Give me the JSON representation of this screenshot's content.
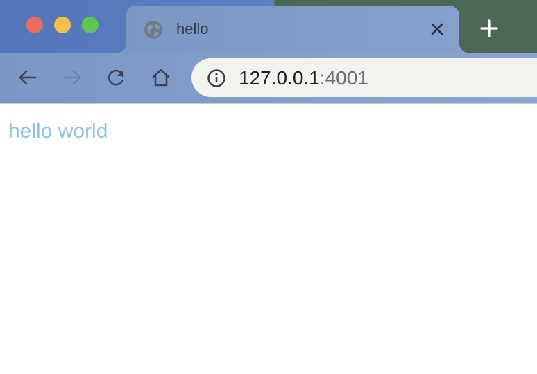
{
  "tab": {
    "title": "hello",
    "favicon_icon": "globe-icon",
    "close_icon": "close-icon"
  },
  "new_tab_icon": "plus-icon",
  "toolbar": {
    "back_icon": "arrow-left-icon",
    "forward_icon": "arrow-right-icon",
    "reload_icon": "reload-icon",
    "home_icon": "home-icon",
    "site_info_icon": "info-icon"
  },
  "address": {
    "host": "127.0.0.1",
    "port": ":4001"
  },
  "page": {
    "text": "hello world"
  },
  "colors": {
    "traffic_close": "#ed6a5e",
    "traffic_minimize": "#f5bf4f",
    "traffic_zoom": "#61c554",
    "page_text": "#8ec5de"
  }
}
